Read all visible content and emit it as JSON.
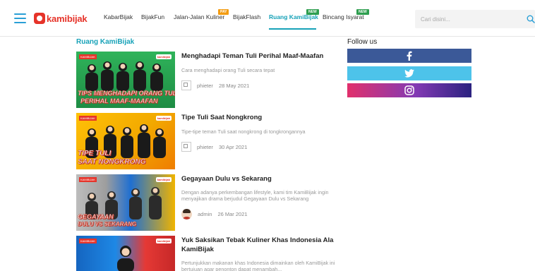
{
  "header": {
    "logo_text": "kamibijak",
    "nav": [
      {
        "label": "KabarBijak",
        "badge": ""
      },
      {
        "label": "BijakFun",
        "badge": ""
      },
      {
        "label": "Jalan-Jalan Kuliner",
        "badge": "PAY"
      },
      {
        "label": "BijakFlash",
        "badge": ""
      },
      {
        "label": "Ruang KamiBijak",
        "badge": "NEW",
        "active": true
      },
      {
        "label": "Bincang Isyarat",
        "badge": "NEW"
      }
    ],
    "search_placeholder": "Cari disini..."
  },
  "main": {
    "section_title": "Ruang KamiBijak",
    "articles": [
      {
        "title": "Menghadapi Teman Tuli Perihal Maaf-Maafan",
        "description": "Cara menghadapi orang Tuli secara tepat",
        "author": "phieter",
        "date": "28 May 2021",
        "thumb_caption": [
          "TIPS MENGHADAPI ORANG TULI",
          "PERIHAL MAAF-MAAFAN"
        ],
        "thumb_colors": [
          "#2e9e4f",
          "#1e7f3a"
        ]
      },
      {
        "title": "Tipe Tuli Saat Nongkrong",
        "description": "Tipe-tipe teman Tuli saat nongkrong di tongkrongannya",
        "author": "phieter",
        "date": "30 Apr 2021",
        "thumb_caption": [
          "TIPE TULI",
          "SAAT NONGKRONG"
        ],
        "thumb_colors": [
          "#f2b705",
          "#f08a00"
        ]
      },
      {
        "title": "Gegayaan Dulu vs Sekarang",
        "description": "Dengan adanya perkembangan lifestyle, kami tim KamiBijak ingin menyajikan drama berjudul Gegayaan Dulu vs Sekarang",
        "author": "admin",
        "date": "26 Mar 2021",
        "thumb_caption": [
          "GEGAYAAN",
          "DULU VS SEKARANG"
        ],
        "thumb_colors": [
          "#1f6fd1",
          "#e0a800"
        ]
      },
      {
        "title": "Yuk Saksikan Tebak Kuliner Khas Indonesia Ala KamiBijak",
        "description": "Pertunjukkan makanan khas Indonesia dimainkan oleh KamiBijak ini bertujuan agar penonton dapat menambah...",
        "author": "",
        "date": "",
        "thumb_caption": [],
        "thumb_colors": [
          "#1565c0",
          "#e53935"
        ]
      }
    ]
  },
  "sidebar": {
    "follow_title": "Follow us",
    "socials": [
      "facebook-icon",
      "twitter-icon",
      "instagram-icon"
    ]
  },
  "colors": {
    "accent": "#17a2b8",
    "brand": "#e63329",
    "facebook": "#3b5998",
    "twitter": "#4dc3ea",
    "instagram_start": "#e1306c",
    "instagram_end": "#2b2280"
  }
}
